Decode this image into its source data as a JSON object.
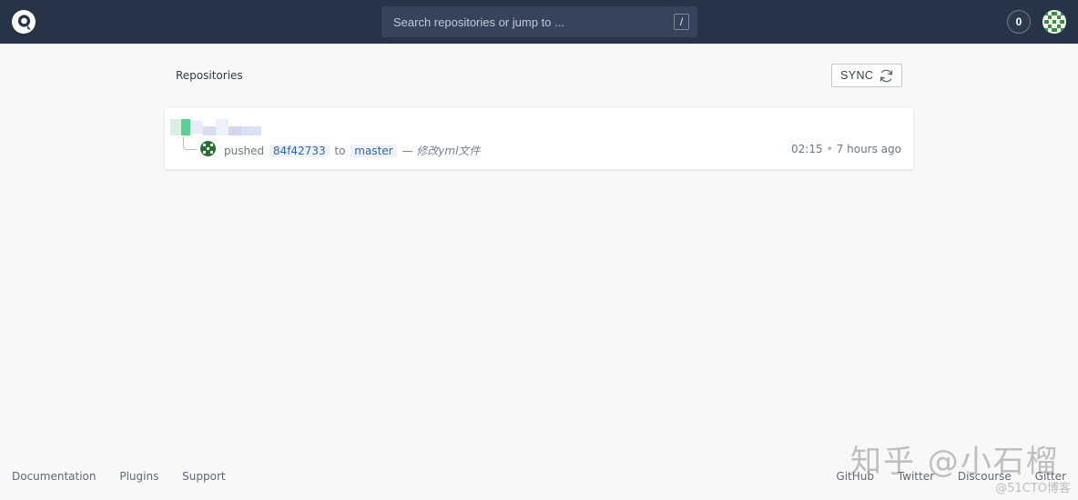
{
  "header": {
    "search_placeholder": "Search repositories or jump to ...",
    "search_shortcut": "/",
    "notification_count": "0"
  },
  "repositories": {
    "title": "Repositories",
    "sync_label": "SYNC",
    "items": [
      {
        "action": "pushed",
        "commit": "84f42733",
        "to_word": "to",
        "branch": "master",
        "separator": "—",
        "message": "修改yml文件",
        "time": "02:15",
        "ago": "7 hours ago"
      }
    ]
  },
  "footer": {
    "links_left": [
      "Documentation",
      "Plugins",
      "Support"
    ],
    "links_right": [
      "GitHub",
      "Twitter",
      "Discourse",
      "Gitter"
    ]
  },
  "watermark": {
    "main": "知乎 @小石榴",
    "site": "@51CTO博客"
  },
  "colors": {
    "topbar": "#273447",
    "accent": "#2d67b0",
    "background": "#f8f8f9"
  },
  "icons": [
    "drone-logo-icon",
    "refresh-icon",
    "identicon-avatar"
  ]
}
